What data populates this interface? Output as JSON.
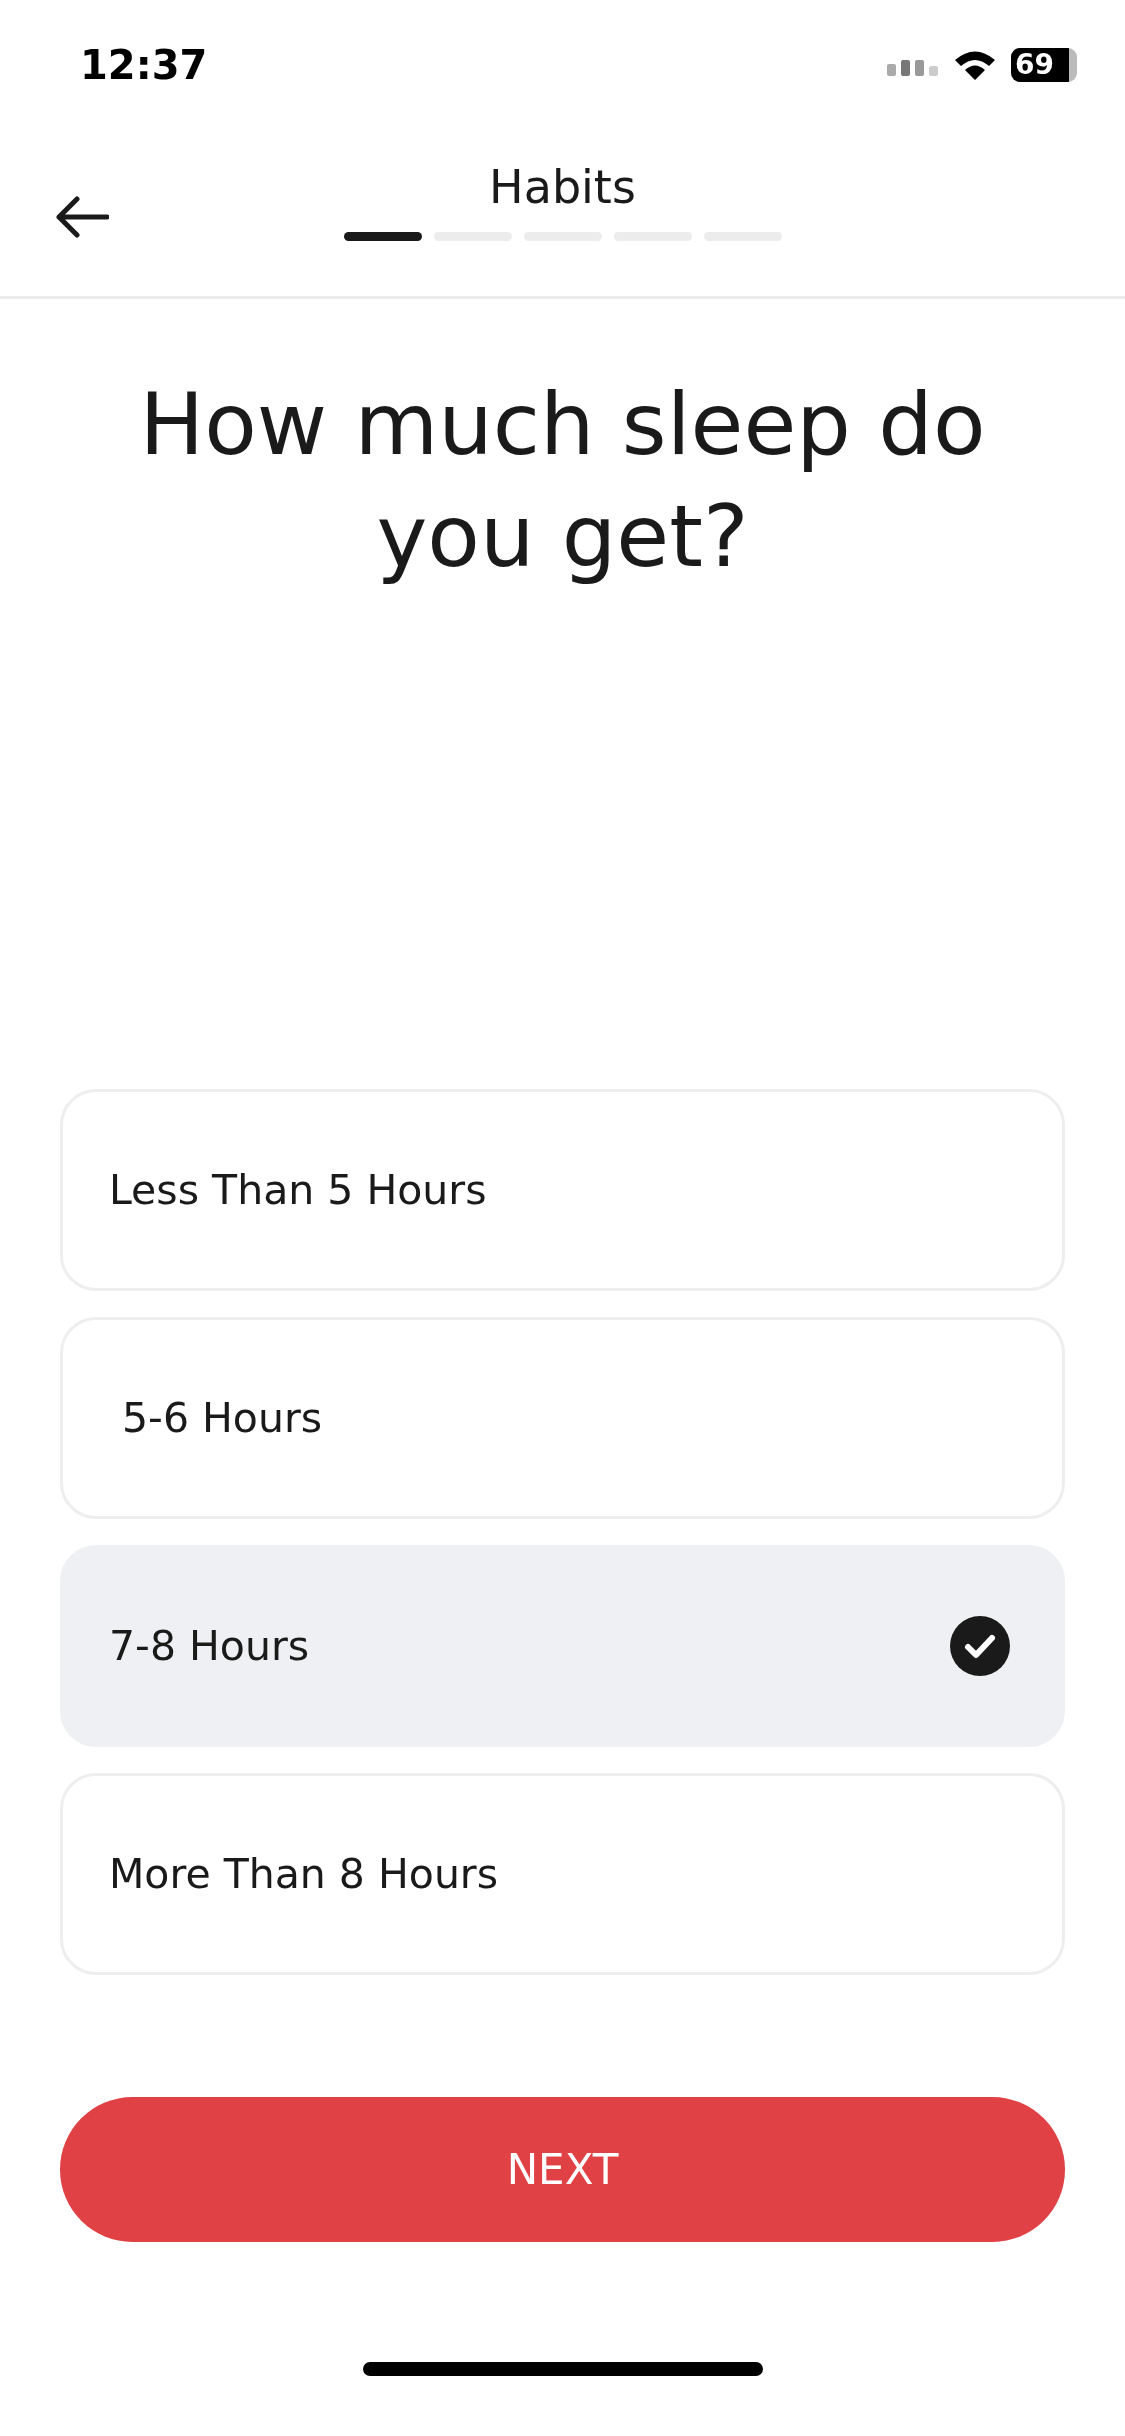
{
  "status_bar": {
    "time": "12:37",
    "battery": "69"
  },
  "header": {
    "title": "Habits",
    "steps": [
      {
        "active": true
      },
      {
        "active": false
      },
      {
        "active": false
      },
      {
        "active": false
      },
      {
        "active": false
      }
    ]
  },
  "question": "How much sleep do you get?",
  "options": [
    {
      "label": "Less Than 5 Hours",
      "selected": false
    },
    {
      "label": " 5-6 Hours",
      "selected": false
    },
    {
      "label": "7-8 Hours",
      "selected": true
    },
    {
      "label": "More Than 8 Hours",
      "selected": false
    }
  ],
  "next_button": "NEXT"
}
